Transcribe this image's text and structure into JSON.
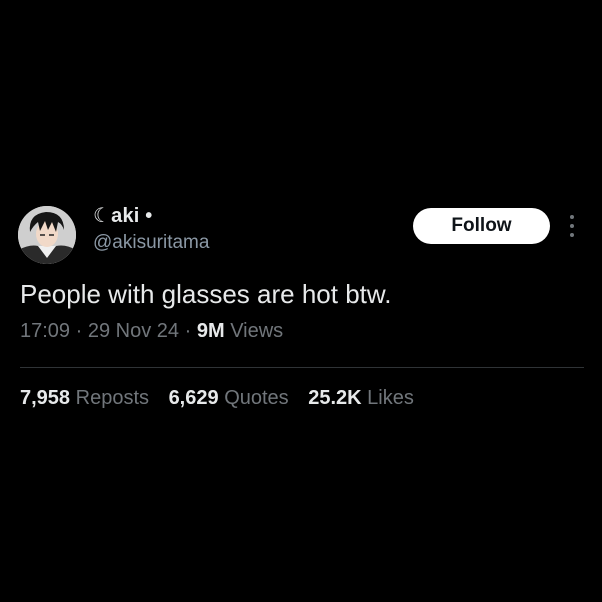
{
  "author": {
    "display_name": "☾aki •",
    "handle": "@akisuritama"
  },
  "actions": {
    "follow_label": "Follow",
    "more_icon": "more-vertical-icon"
  },
  "tweet": {
    "text": "People with glasses are hot btw.",
    "time": "17:09",
    "separator": "·",
    "date": "29 Nov 24",
    "views_count": "9M",
    "views_label": "Views"
  },
  "stats": {
    "reposts_count": "7,958",
    "reposts_label": "Reposts",
    "quotes_count": "6,629",
    "quotes_label": "Quotes",
    "likes_count": "25.2K",
    "likes_label": "Likes"
  },
  "colors": {
    "background": "#000000",
    "primary_text": "#e7e9ea",
    "secondary_text": "#71767b",
    "follow_button_bg": "#ffffff",
    "divider": "#2f3336"
  }
}
